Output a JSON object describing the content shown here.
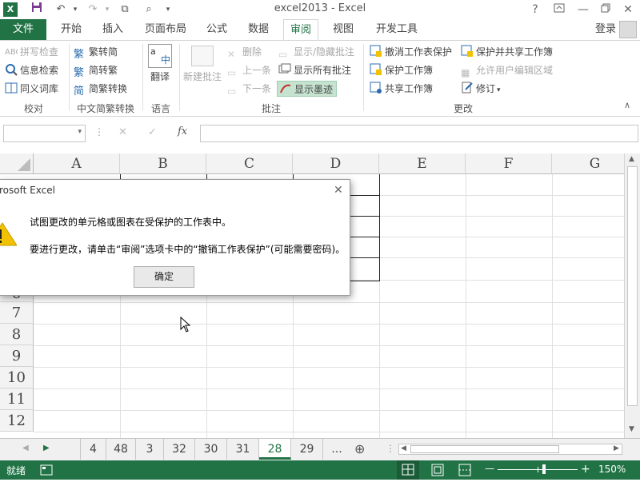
{
  "window": {
    "title": "excel2013 - Excel",
    "help_label": "?",
    "minimize_label": "—",
    "close_label": "✕"
  },
  "tabs": {
    "file": "文件",
    "items": [
      "开始",
      "插入",
      "页面布局",
      "公式",
      "数据",
      "审阅",
      "视图",
      "开发工具"
    ],
    "active": "审阅",
    "login": "登录"
  },
  "ribbon": {
    "proofing": {
      "spell": "拼写检查",
      "research": "信息检索",
      "thesaurus": "同义词库",
      "group": "校对"
    },
    "chinese": {
      "to_simplified": "繁转简",
      "to_traditional": "简转繁",
      "convert": "简繁转换",
      "group": "中文简繁转换"
    },
    "language": {
      "translate": "翻译",
      "group": "语言"
    },
    "comments": {
      "new": "新建批注",
      "delete": "删除",
      "prev": "上一条",
      "next": "下一条",
      "show_hide": "显示/隐藏批注",
      "show_all": "显示所有批注",
      "show_ink": "显示墨迹",
      "group": "批注"
    },
    "changes": {
      "unprotect_sheet": "撤消工作表保护",
      "protect_workbook": "保护工作簿",
      "share_workbook": "共享工作簿",
      "protect_share": "保护并共享工作簿",
      "allow_edit": "允许用户编辑区域",
      "track": "修订",
      "group": "更改"
    }
  },
  "formula_bar": {
    "fx": "fx",
    "cancel": "✕",
    "enter": "✓"
  },
  "grid": {
    "columns": [
      "A",
      "B",
      "C",
      "D",
      "E",
      "F",
      "G"
    ],
    "rows": [
      "7",
      "8",
      "9",
      "10",
      "11",
      "12"
    ],
    "row_partial": "6"
  },
  "dialog": {
    "title": "rosoft Excel",
    "message1": "试图更改的单元格或图表在受保护的工作表中。",
    "message2": "要进行更改，请单击“审阅”选项卡中的“撤销工作表保护”(可能需要密码)。",
    "ok": "确定",
    "close": "✕",
    "warn": "!"
  },
  "sheets": {
    "tabs": [
      "4",
      "48",
      "3",
      "32",
      "30",
      "31",
      "28",
      "29"
    ],
    "active": "28",
    "more": "...",
    "add": "⊕"
  },
  "status": {
    "ready": "就绪",
    "zoom": "150%",
    "zoom_minus": "—",
    "zoom_plus": "+"
  },
  "colors": {
    "accent": "#217346",
    "warning": "#f2c100"
  }
}
